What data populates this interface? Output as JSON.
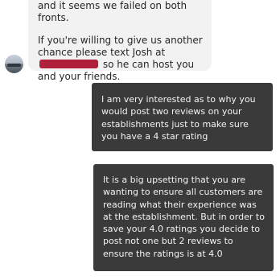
{
  "thread": {
    "received_message": {
      "line1": "and it seems we failed on both fronts.",
      "line2_prefix": "If you're willing to give us another chance please text Josh at ",
      "line2_suffix": " so he can host you and your friends."
    },
    "sent_messages": [
      {
        "text": "I am very interested as to why you would post two reviews on your establishments just to make sure you have a 4 star rating"
      },
      {
        "text": "It is a big upsetting that you are wanting to ensure all customers are reading what their experience was at the establishment. But in order to save your 4.0 ratings you decide to post not one but 2 reviews to ensure the ratings is at 4.0"
      }
    ]
  },
  "colors": {
    "received_bubble": "#f2f2f2",
    "sent_bubble": "#3a3a3a",
    "redaction": "#b0203a"
  }
}
